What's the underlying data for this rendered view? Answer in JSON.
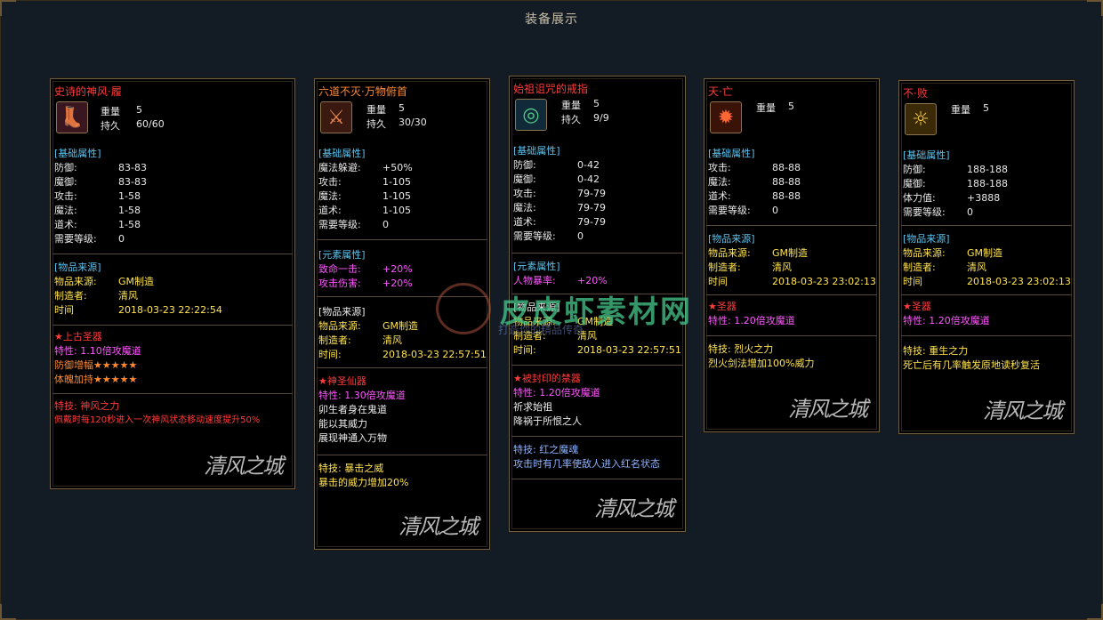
{
  "window": {
    "title": "装备展示"
  },
  "watermark": {
    "main": "皮皮虾素材网",
    "sub": "打造你的精品传奇"
  },
  "colors": {
    "name_red": "#ff3b3b",
    "section_cyan": "#5cc4ef",
    "magenta": "#ff57ff",
    "yellow": "#ffe34f",
    "background": "#131c25"
  },
  "cards": [
    {
      "name": "史诗的神风·履",
      "icon": "boots-icon",
      "weight_label": "重量",
      "weight": "5",
      "durability_label": "持久",
      "durability": "60/60",
      "base_header": "[基础属性]",
      "base": [
        {
          "k": "防御:",
          "v": "83-83"
        },
        {
          "k": "魔御:",
          "v": "83-83"
        },
        {
          "k": "攻击:",
          "v": "1-58"
        },
        {
          "k": "魔法:",
          "v": "1-58"
        },
        {
          "k": "道术:",
          "v": "1-58"
        },
        {
          "k": "需要等级:",
          "v": "0"
        }
      ],
      "source_header": "[物品来源]",
      "source": [
        {
          "k": "物品来源:",
          "v": "GM制造"
        },
        {
          "k": "制造者:",
          "v": "清风"
        },
        {
          "k": "时间",
          "v": "2018-03-23 22:22:54"
        }
      ],
      "relic_title": "★上古圣器",
      "relic_lines": [
        "特性: 1.10倍攻魔道",
        "防御增幅★★★★★",
        "体魄加持★★★★★"
      ],
      "skill_title": "特技: 神风之力",
      "skill_lines": [
        "佩戴时每120秒进入一次神风状态移动速度提升50%"
      ],
      "logo": "清风之城"
    },
    {
      "name": "六道不灭·万物俯首",
      "icon": "swords-icon",
      "weight_label": "重量",
      "weight": "5",
      "durability_label": "持久",
      "durability": "30/30",
      "base_header": "[基础属性]",
      "base": [
        {
          "k": "魔法躲避:",
          "v": "+50%"
        },
        {
          "k": "攻击:",
          "v": "1-105"
        },
        {
          "k": "魔法:",
          "v": "1-105"
        },
        {
          "k": "道术:",
          "v": "1-105"
        },
        {
          "k": "需要等级:",
          "v": "0"
        }
      ],
      "element_header": "[元素属性]",
      "element": [
        {
          "k": "致命一击:",
          "v": "+20%"
        },
        {
          "k": "攻击伤害:",
          "v": "+20%"
        }
      ],
      "source_header": "[物品来源]",
      "source": [
        {
          "k": "物品来源:",
          "v": "GM制造"
        },
        {
          "k": "制造者:",
          "v": "清风"
        },
        {
          "k": "时间:",
          "v": "2018-03-23 22:57:51"
        }
      ],
      "relic_title": "★神圣仙器",
      "relic_lines": [
        "特性: 1.30倍攻魔道"
      ],
      "lore_lines": [
        "卯生者身在鬼道",
        "能以其威力",
        "展现神通入万物"
      ],
      "skill_title": "特技: 暴击之威",
      "skill_lines": [
        "暴击的威力增加20%"
      ],
      "logo": "清风之城"
    },
    {
      "name": "始祖诅咒的戒指",
      "icon": "ring-icon",
      "weight_label": "重量",
      "weight": "5",
      "durability_label": "持久",
      "durability": "9/9",
      "base_header": "[基础属性]",
      "base": [
        {
          "k": "防御:",
          "v": "0-42"
        },
        {
          "k": "魔御:",
          "v": "0-42"
        },
        {
          "k": "攻击:",
          "v": "79-79"
        },
        {
          "k": "魔法:",
          "v": "79-79"
        },
        {
          "k": "道术:",
          "v": "79-79"
        },
        {
          "k": "需要等级:",
          "v": "0"
        }
      ],
      "element_header": "[元素属性]",
      "element": [
        {
          "k": "人物暴率:",
          "v": "+20%"
        }
      ],
      "source_header": "[物品来源]",
      "source": [
        {
          "k": "物品来源:",
          "v": "GM制造"
        },
        {
          "k": "制造者:",
          "v": "清风"
        },
        {
          "k": "时间:",
          "v": "2018-03-23 22:57:51"
        }
      ],
      "relic_title": "★被封印的禁器",
      "relic_lines": [
        "特性: 1.20倍攻魔道"
      ],
      "lore_lines": [
        "祈求始祖",
        "降祸于所恨之人"
      ],
      "skill_title": "特技: 红之魔魂",
      "skill_lines": [
        "攻击时有几率使敌人进入红名状态"
      ],
      "logo": "清风之城"
    },
    {
      "name": "天·亡",
      "icon": "fire-icon",
      "weight_label": "重量",
      "weight": "5",
      "base_header": "[基础属性]",
      "base": [
        {
          "k": "攻击:",
          "v": "88-88"
        },
        {
          "k": "魔法:",
          "v": "88-88"
        },
        {
          "k": "道术:",
          "v": "88-88"
        },
        {
          "k": "需要等级:",
          "v": "0"
        }
      ],
      "source_header": "[物品来源]",
      "source": [
        {
          "k": "物品来源:",
          "v": "GM制造"
        },
        {
          "k": "制造者:",
          "v": "清风"
        },
        {
          "k": "时间",
          "v": "2018-03-23 23:02:13"
        }
      ],
      "relic_title": "★圣器",
      "relic_lines": [
        "特性: 1.20倍攻魔道"
      ],
      "skill_title": "特技: 烈火之力",
      "skill_lines": [
        "烈火剑法增加100%威力"
      ],
      "logo": "清风之城"
    },
    {
      "name": "不·败",
      "icon": "figure-icon",
      "weight_label": "重量",
      "weight": "5",
      "base_header": "[基础属性]",
      "base": [
        {
          "k": "防御:",
          "v": "188-188"
        },
        {
          "k": "魔御:",
          "v": "188-188"
        },
        {
          "k": "体力值:",
          "v": "+3888"
        },
        {
          "k": "需要等级:",
          "v": "0"
        }
      ],
      "source_header": "[物品来源]",
      "source": [
        {
          "k": "物品来源:",
          "v": "GM制造"
        },
        {
          "k": "制造者:",
          "v": "清风"
        },
        {
          "k": "时间",
          "v": "2018-03-23 23:02:13"
        }
      ],
      "relic_title": "★圣器",
      "relic_lines": [
        "特性: 1.20倍攻魔道"
      ],
      "skill_title": "特技: 重生之力",
      "skill_lines": [
        "死亡后有几率触发原地读秒复活"
      ],
      "logo": "清风之城"
    }
  ]
}
